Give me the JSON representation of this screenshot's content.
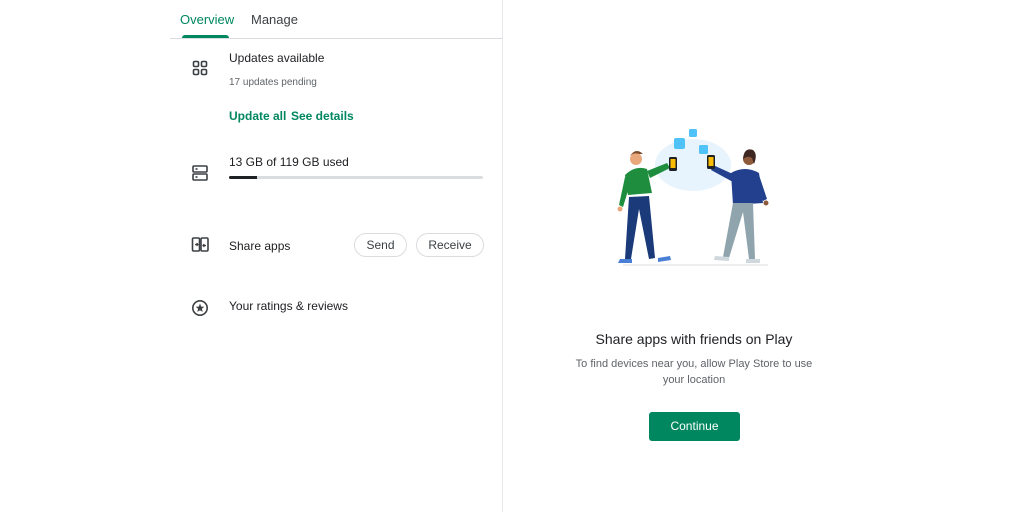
{
  "tabs": {
    "overview": "Overview",
    "manage": "Manage"
  },
  "updates": {
    "title": "Updates available",
    "subtitle": "17 updates pending",
    "update_all": "Update all",
    "see_details": "See details",
    "icon": "apps-grid-icon"
  },
  "storage": {
    "label": "13 GB of 119 GB used",
    "used_fraction": 0.11,
    "icon": "storage-icon"
  },
  "share": {
    "label": "Share apps",
    "send": "Send",
    "receive": "Receive",
    "icon": "share-devices-icon"
  },
  "ratings": {
    "label": "Your ratings & reviews",
    "icon": "star-circle-icon"
  },
  "share_panel": {
    "title": "Share apps with friends on Play",
    "description": "To find devices near you, allow Play Store to use your location",
    "continue": "Continue"
  },
  "colors": {
    "accent": "#01875f",
    "divider": "#dadce0"
  }
}
